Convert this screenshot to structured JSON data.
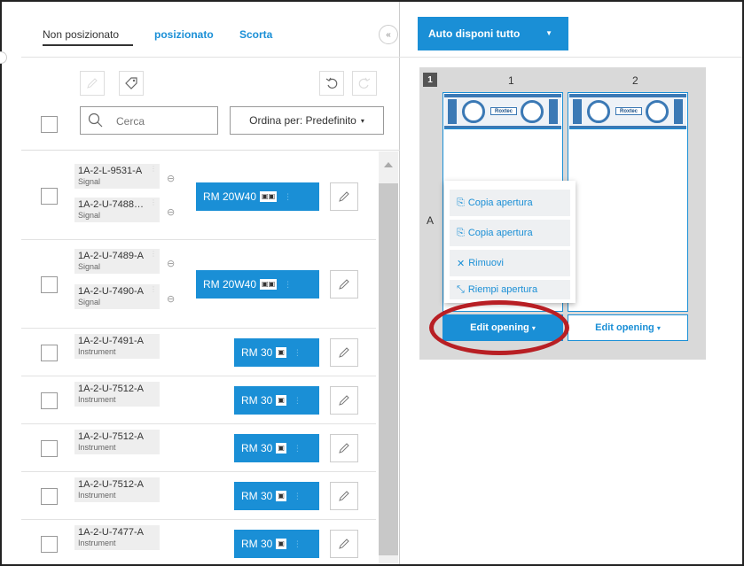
{
  "tabs": [
    {
      "label": "Non posizionato",
      "active": true
    },
    {
      "label": "posizionato",
      "active": false
    },
    {
      "label": "Scorta",
      "active": false
    }
  ],
  "collapse": {
    "label": "«"
  },
  "toolbar": {
    "search_placeholder": "Cerca",
    "sort_label": "Ordina per: Predefinito"
  },
  "rows": [
    {
      "tags": [
        {
          "code": "1A-2-L-9531-A",
          "type": "Signal"
        },
        {
          "code": "1A-2-U-7488…",
          "type": "Signal"
        }
      ],
      "rm": "RM 20W40",
      "icons": 2
    },
    {
      "tags": [
        {
          "code": "1A-2-U-7489-A",
          "type": "Signal"
        },
        {
          "code": "1A-2-U-7490-A",
          "type": "Signal"
        }
      ],
      "rm": "RM 20W40",
      "icons": 2
    },
    {
      "tags": [
        {
          "code": "1A-2-U-7491-A",
          "type": "Instrument"
        }
      ],
      "rm": "RM 30",
      "icons": 1
    },
    {
      "tags": [
        {
          "code": "1A-2-U-7512-A",
          "type": "Instrument"
        }
      ],
      "rm": "RM 30",
      "icons": 1
    },
    {
      "tags": [
        {
          "code": "1A-2-U-7512-A",
          "type": "Instrument"
        }
      ],
      "rm": "RM 30",
      "icons": 1
    },
    {
      "tags": [
        {
          "code": "1A-2-U-7512-A",
          "type": "Instrument"
        }
      ],
      "rm": "RM 30",
      "icons": 1
    },
    {
      "tags": [
        {
          "code": "1A-2-U-7477-A",
          "type": "Instrument"
        }
      ],
      "rm": "RM 30",
      "icons": 1
    }
  ],
  "right": {
    "auto_button": "Auto disponi tutto",
    "row_number": "1",
    "columns": [
      "1",
      "2"
    ],
    "row_letter": "A",
    "panel_logo": "Roxtec",
    "edit_opening": "Edit opening",
    "menu": [
      "Copia apertura",
      "Copia apertura",
      "Rimuovi",
      "Riempi apertura"
    ]
  },
  "colors": {
    "accent": "#1a8fd6",
    "highlight": "#b81f24"
  }
}
